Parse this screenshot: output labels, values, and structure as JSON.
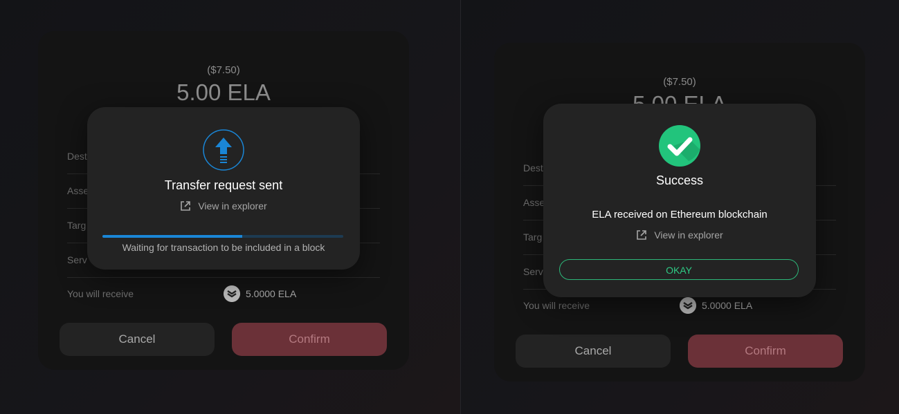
{
  "panels": [
    {
      "card": {
        "fiat": "($7.50)",
        "amount": "5.00 ELA",
        "rows": [
          "Dest",
          "Asse",
          "Targ",
          "Serv"
        ],
        "receive_label": "You will receive",
        "receive_value": "5.0000 ELA",
        "cancel_label": "Cancel",
        "confirm_label": "Confirm"
      },
      "modal": {
        "title": "Transfer request sent",
        "explorer_label": "View in explorer",
        "progress": 0.58,
        "status": "Waiting for transaction to be included in a block"
      }
    },
    {
      "card": {
        "fiat": "($7.50)",
        "amount": "5.00 ELA",
        "rows": [
          "Dest",
          "Asse",
          "Targ",
          "Serv"
        ],
        "receive_label": "You will receive",
        "receive_value": "5.0000 ELA",
        "cancel_label": "Cancel",
        "confirm_label": "Confirm"
      },
      "modal": {
        "title": "Success",
        "message": "ELA received on Ethereum blockchain",
        "explorer_label": "View in explorer",
        "okay_label": "OKAY"
      }
    }
  ],
  "colors": {
    "accent_blue": "#1a86d6",
    "success_green": "#2ecb85",
    "confirm_bg": "#6b3138"
  },
  "icons": {
    "transfer": "upload-arrow-icon",
    "success": "check-circle-icon",
    "explorer": "external-link-icon",
    "coin": "ela-coin-icon"
  }
}
